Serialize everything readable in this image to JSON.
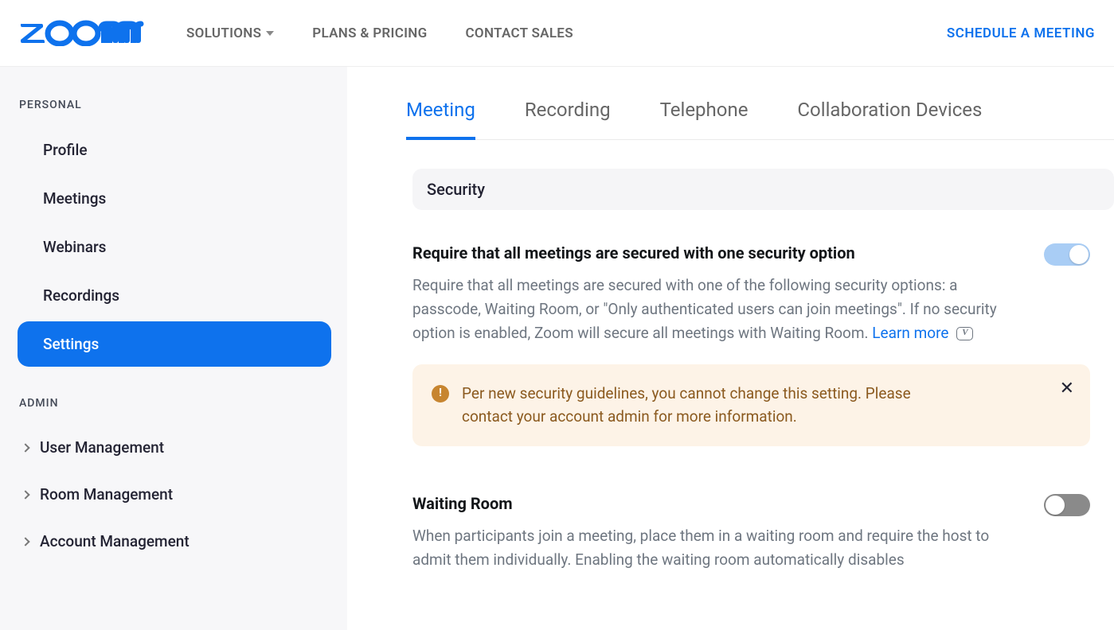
{
  "topnav": {
    "items": [
      {
        "label": "SOLUTIONS",
        "has_dropdown": true
      },
      {
        "label": "PLANS & PRICING",
        "has_dropdown": false
      },
      {
        "label": "CONTACT SALES",
        "has_dropdown": false
      }
    ],
    "schedule": "SCHEDULE A MEETING"
  },
  "sidebar": {
    "personal_label": "PERSONAL",
    "personal_items": [
      {
        "label": "Profile",
        "active": false
      },
      {
        "label": "Meetings",
        "active": false
      },
      {
        "label": "Webinars",
        "active": false
      },
      {
        "label": "Recordings",
        "active": false
      },
      {
        "label": "Settings",
        "active": true
      }
    ],
    "admin_label": "ADMIN",
    "admin_items": [
      {
        "label": "User Management"
      },
      {
        "label": "Room Management"
      },
      {
        "label": "Account Management"
      }
    ]
  },
  "tabs": [
    {
      "label": "Meeting",
      "active": true
    },
    {
      "label": "Recording",
      "active": false
    },
    {
      "label": "Telephone",
      "active": false
    },
    {
      "label": "Collaboration Devices",
      "active": false
    }
  ],
  "section": {
    "header": "Security",
    "settings": [
      {
        "title": "Require that all meetings are secured with one security option",
        "desc": "Require that all meetings are secured with one of the following security options: a passcode, Waiting Room, or \"Only authenticated users can join meetings\". If no security option is enabled, Zoom will secure all meetings with Waiting Room. ",
        "learn_more": "Learn more",
        "toggle": "on-locked",
        "alert": "Per new security guidelines, you cannot change this setting. Please contact your account admin for more information."
      },
      {
        "title": "Waiting Room",
        "desc": "When participants join a meeting, place them in a waiting room and require the host to admit them individually. Enabling the waiting room automatically disables",
        "toggle": "off"
      }
    ]
  }
}
